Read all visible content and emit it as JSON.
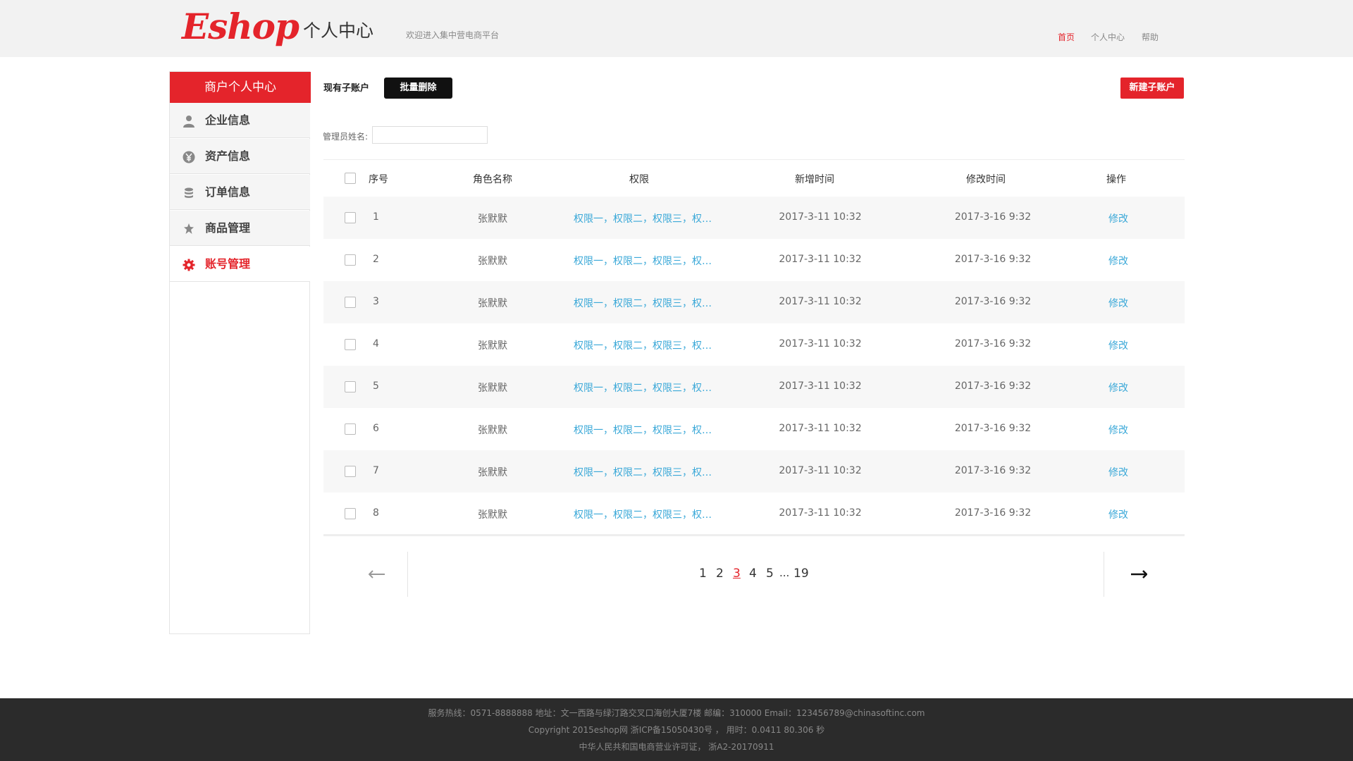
{
  "header": {
    "logo": "Eshop",
    "title": "个人中心",
    "welcome": "欢迎进入集中营电商平台",
    "nav": [
      "首页",
      "个人中心",
      "帮助"
    ],
    "accent": "#e4242b"
  },
  "sidebar": {
    "title": "商户个人中心",
    "items": [
      {
        "label": "企业信息",
        "icon": "user-icon"
      },
      {
        "label": "资产信息",
        "icon": "yen-icon"
      },
      {
        "label": "订单信息",
        "icon": "database-icon"
      },
      {
        "label": "商品管理",
        "icon": "pin-icon"
      },
      {
        "label": "账号管理",
        "icon": "gear-icon"
      }
    ],
    "active_index": 4
  },
  "toolbar": {
    "sub_accounts_label": "现有子账户",
    "batch_delete_label": "批量删除",
    "new_account_label": "新建子账户",
    "filter_label": "管理员姓名:",
    "filter_value": ""
  },
  "table": {
    "headers": [
      "序号",
      "角色名称",
      "权限",
      "新增时间",
      "修改时间",
      "操作"
    ],
    "rows": [
      {
        "no": "1",
        "name": "张默默",
        "perm": "权限一，权限二，权限三，权…",
        "created": "2017-3-11  10:32",
        "modified": "2017-3-16   9:32",
        "action": "修改"
      },
      {
        "no": "2",
        "name": "张默默",
        "perm": "权限一，权限二，权限三，权…",
        "created": "2017-3-11  10:32",
        "modified": "2017-3-16   9:32",
        "action": "修改"
      },
      {
        "no": "3",
        "name": "张默默",
        "perm": "权限一，权限二，权限三，权…",
        "created": "2017-3-11  10:32",
        "modified": "2017-3-16   9:32",
        "action": "修改"
      },
      {
        "no": "4",
        "name": "张默默",
        "perm": "权限一，权限二，权限三，权…",
        "created": "2017-3-11  10:32",
        "modified": "2017-3-16   9:32",
        "action": "修改"
      },
      {
        "no": "5",
        "name": "张默默",
        "perm": "权限一，权限二，权限三，权…",
        "created": "2017-3-11  10:32",
        "modified": "2017-3-16   9:32",
        "action": "修改"
      },
      {
        "no": "6",
        "name": "张默默",
        "perm": "权限一，权限二，权限三，权…",
        "created": "2017-3-11  10:32",
        "modified": "2017-3-16   9:32",
        "action": "修改"
      },
      {
        "no": "7",
        "name": "张默默",
        "perm": "权限一，权限二，权限三，权…",
        "created": "2017-3-11  10:32",
        "modified": "2017-3-16   9:32",
        "action": "修改"
      },
      {
        "no": "8",
        "name": "张默默",
        "perm": "权限一，权限二，权限三，权…",
        "created": "2017-3-11  10:32",
        "modified": "2017-3-16   9:32",
        "action": "修改"
      }
    ],
    "link_color": "#3aa8d8"
  },
  "pagination": {
    "pages": [
      "1",
      "2",
      "3",
      "4",
      "5"
    ],
    "ellipsis": "...",
    "last": "19",
    "current": "3"
  },
  "footer": {
    "line1": "服务热线：0571-8888888      地址：文一西路与绿汀路交叉口海创大厦7楼      邮编：310000      Email：123456789@chinasoftinc.com",
    "line2": "Copyright 2015eshop网    浙ICP备15050430号 ，  用时：0.0411 80.306 秒",
    "line3": "中华人民共和国电商营业许可证，   浙A2-20170911"
  }
}
